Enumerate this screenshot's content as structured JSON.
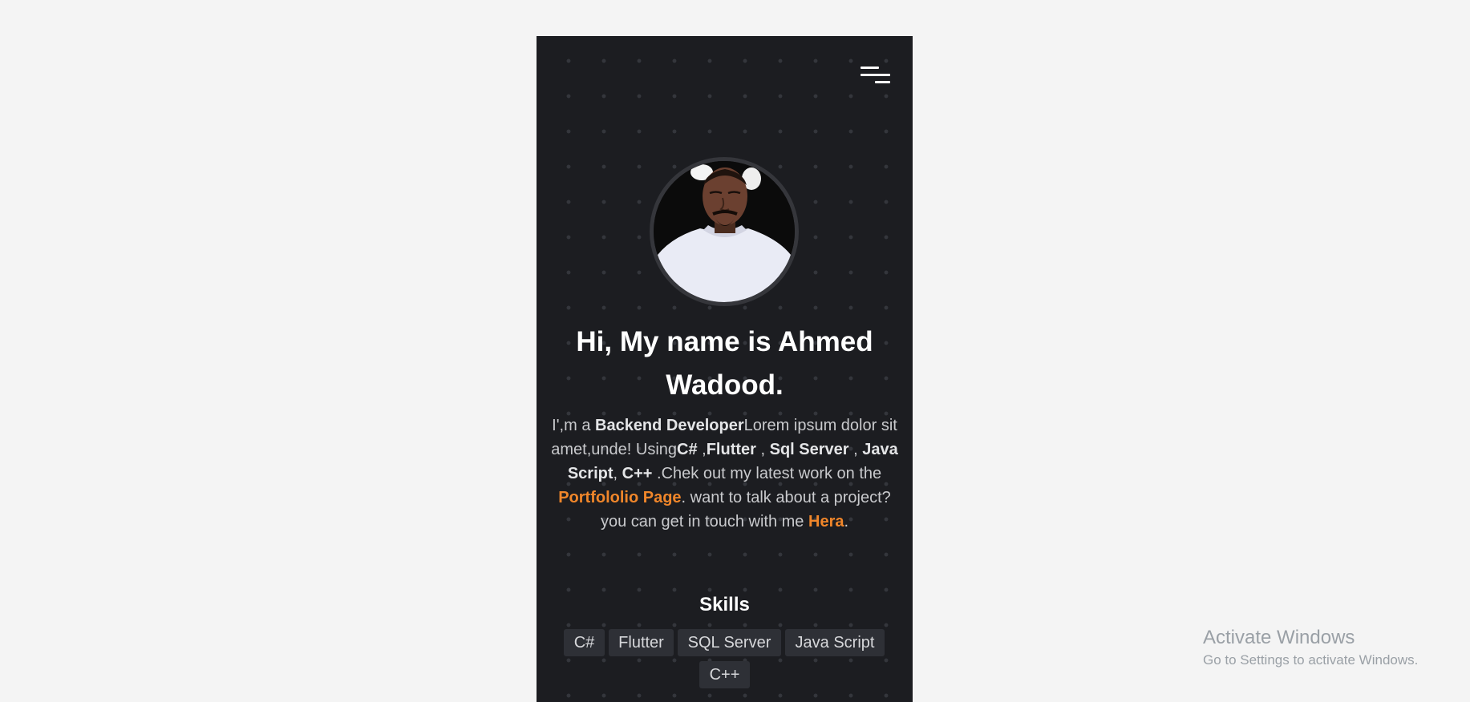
{
  "header": {
    "menu_icon": "hamburger-menu-icon"
  },
  "profile": {
    "greeting": "Hi, My name is Ahmed Wadood."
  },
  "bio": {
    "prefix": "I',m a ",
    "role": "Backend Developer",
    "intro": "Lorem ipsum dolor sit amet,unde! Using",
    "skill_csharp": "C#",
    "sep1": " ,",
    "skill_flutter": "Flutter",
    "sep2": " , ",
    "skill_sql": "Sql Server",
    "sep3": " , ",
    "skill_js": "Java Script",
    "sep4": ", ",
    "skill_cpp": "C++",
    "mid": " .Chek out my latest work on the ",
    "portfolio_link": "Portfololio Page",
    "after_link": ". want to talk about a project? you can get in touch with me ",
    "contact_link": "Hera",
    "end": "."
  },
  "skills": {
    "title": "Skills",
    "tags": [
      "C#",
      "Flutter",
      "SQL Server",
      "Java Script",
      "C++"
    ]
  },
  "watermark": {
    "line1": "Activate Windows",
    "line2": "Go to Settings to activate Windows."
  },
  "colors": {
    "background": "#1c1d21",
    "accent": "#f0862a",
    "tag_background": "#2e3036",
    "page_background": "#f4f4f4"
  }
}
